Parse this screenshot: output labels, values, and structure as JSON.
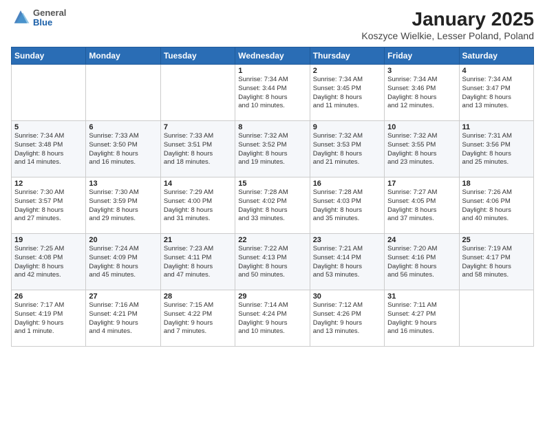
{
  "header": {
    "logo": {
      "general": "General",
      "blue": "Blue"
    },
    "title": "January 2025",
    "subtitle": "Koszyce Wielkie, Lesser Poland, Poland"
  },
  "days_of_week": [
    "Sunday",
    "Monday",
    "Tuesday",
    "Wednesday",
    "Thursday",
    "Friday",
    "Saturday"
  ],
  "weeks": [
    [
      {
        "day": "",
        "info": ""
      },
      {
        "day": "",
        "info": ""
      },
      {
        "day": "",
        "info": ""
      },
      {
        "day": "1",
        "info": "Sunrise: 7:34 AM\nSunset: 3:44 PM\nDaylight: 8 hours\nand 10 minutes."
      },
      {
        "day": "2",
        "info": "Sunrise: 7:34 AM\nSunset: 3:45 PM\nDaylight: 8 hours\nand 11 minutes."
      },
      {
        "day": "3",
        "info": "Sunrise: 7:34 AM\nSunset: 3:46 PM\nDaylight: 8 hours\nand 12 minutes."
      },
      {
        "day": "4",
        "info": "Sunrise: 7:34 AM\nSunset: 3:47 PM\nDaylight: 8 hours\nand 13 minutes."
      }
    ],
    [
      {
        "day": "5",
        "info": "Sunrise: 7:34 AM\nSunset: 3:48 PM\nDaylight: 8 hours\nand 14 minutes."
      },
      {
        "day": "6",
        "info": "Sunrise: 7:33 AM\nSunset: 3:50 PM\nDaylight: 8 hours\nand 16 minutes."
      },
      {
        "day": "7",
        "info": "Sunrise: 7:33 AM\nSunset: 3:51 PM\nDaylight: 8 hours\nand 18 minutes."
      },
      {
        "day": "8",
        "info": "Sunrise: 7:32 AM\nSunset: 3:52 PM\nDaylight: 8 hours\nand 19 minutes."
      },
      {
        "day": "9",
        "info": "Sunrise: 7:32 AM\nSunset: 3:53 PM\nDaylight: 8 hours\nand 21 minutes."
      },
      {
        "day": "10",
        "info": "Sunrise: 7:32 AM\nSunset: 3:55 PM\nDaylight: 8 hours\nand 23 minutes."
      },
      {
        "day": "11",
        "info": "Sunrise: 7:31 AM\nSunset: 3:56 PM\nDaylight: 8 hours\nand 25 minutes."
      }
    ],
    [
      {
        "day": "12",
        "info": "Sunrise: 7:30 AM\nSunset: 3:57 PM\nDaylight: 8 hours\nand 27 minutes."
      },
      {
        "day": "13",
        "info": "Sunrise: 7:30 AM\nSunset: 3:59 PM\nDaylight: 8 hours\nand 29 minutes."
      },
      {
        "day": "14",
        "info": "Sunrise: 7:29 AM\nSunset: 4:00 PM\nDaylight: 8 hours\nand 31 minutes."
      },
      {
        "day": "15",
        "info": "Sunrise: 7:28 AM\nSunset: 4:02 PM\nDaylight: 8 hours\nand 33 minutes."
      },
      {
        "day": "16",
        "info": "Sunrise: 7:28 AM\nSunset: 4:03 PM\nDaylight: 8 hours\nand 35 minutes."
      },
      {
        "day": "17",
        "info": "Sunrise: 7:27 AM\nSunset: 4:05 PM\nDaylight: 8 hours\nand 37 minutes."
      },
      {
        "day": "18",
        "info": "Sunrise: 7:26 AM\nSunset: 4:06 PM\nDaylight: 8 hours\nand 40 minutes."
      }
    ],
    [
      {
        "day": "19",
        "info": "Sunrise: 7:25 AM\nSunset: 4:08 PM\nDaylight: 8 hours\nand 42 minutes."
      },
      {
        "day": "20",
        "info": "Sunrise: 7:24 AM\nSunset: 4:09 PM\nDaylight: 8 hours\nand 45 minutes."
      },
      {
        "day": "21",
        "info": "Sunrise: 7:23 AM\nSunset: 4:11 PM\nDaylight: 8 hours\nand 47 minutes."
      },
      {
        "day": "22",
        "info": "Sunrise: 7:22 AM\nSunset: 4:13 PM\nDaylight: 8 hours\nand 50 minutes."
      },
      {
        "day": "23",
        "info": "Sunrise: 7:21 AM\nSunset: 4:14 PM\nDaylight: 8 hours\nand 53 minutes."
      },
      {
        "day": "24",
        "info": "Sunrise: 7:20 AM\nSunset: 4:16 PM\nDaylight: 8 hours\nand 56 minutes."
      },
      {
        "day": "25",
        "info": "Sunrise: 7:19 AM\nSunset: 4:17 PM\nDaylight: 8 hours\nand 58 minutes."
      }
    ],
    [
      {
        "day": "26",
        "info": "Sunrise: 7:17 AM\nSunset: 4:19 PM\nDaylight: 9 hours\nand 1 minute."
      },
      {
        "day": "27",
        "info": "Sunrise: 7:16 AM\nSunset: 4:21 PM\nDaylight: 9 hours\nand 4 minutes."
      },
      {
        "day": "28",
        "info": "Sunrise: 7:15 AM\nSunset: 4:22 PM\nDaylight: 9 hours\nand 7 minutes."
      },
      {
        "day": "29",
        "info": "Sunrise: 7:14 AM\nSunset: 4:24 PM\nDaylight: 9 hours\nand 10 minutes."
      },
      {
        "day": "30",
        "info": "Sunrise: 7:12 AM\nSunset: 4:26 PM\nDaylight: 9 hours\nand 13 minutes."
      },
      {
        "day": "31",
        "info": "Sunrise: 7:11 AM\nSunset: 4:27 PM\nDaylight: 9 hours\nand 16 minutes."
      },
      {
        "day": "",
        "info": ""
      }
    ]
  ]
}
